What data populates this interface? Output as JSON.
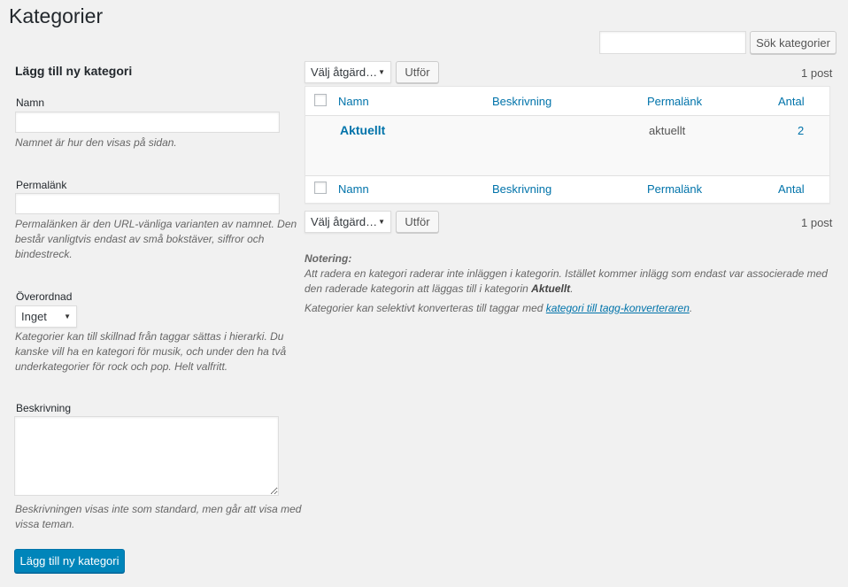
{
  "page": {
    "title": "Kategorier"
  },
  "search": {
    "button_label": "Sök kategorier",
    "value": ""
  },
  "add_form": {
    "heading": "Lägg till ny kategori",
    "name_label": "Namn",
    "name_value": "",
    "name_desc": "Namnet är hur den visas på sidan.",
    "slug_label": "Permalänk",
    "slug_value": "",
    "slug_desc_1": "Permalänken är den URL-vänliga varianten av namnet. Den",
    "slug_desc_2": "består vanligtvis endast av små bokstäver, siffror och",
    "slug_desc_3": "bindestreck.",
    "parent_label": "Överordnad",
    "parent_value": "Inget",
    "parent_desc_1": "Kategorier kan till skillnad från taggar sättas i hierarki. Du",
    "parent_desc_2": "kanske vill ha en kategori för musik, och under den ha två",
    "parent_desc_3": "underkategorier för rock och pop. Helt valfritt.",
    "desc_label": "Beskrivning",
    "desc_value": "",
    "desc_desc_1": "Beskrivningen visas inte som standard, men går att visa med",
    "desc_desc_2": "vissa teman.",
    "submit_label": "Lägg till ny kategori"
  },
  "bulk": {
    "select_label": "Välj åtgärd…",
    "apply_label": "Utför",
    "count_text": "1 post"
  },
  "table": {
    "columns": [
      "Namn",
      "Beskrivning",
      "Permalänk",
      "Antal"
    ],
    "rows": [
      {
        "name": "Aktuellt",
        "description": "",
        "slug": "aktuellt",
        "count": "2"
      }
    ]
  },
  "note": {
    "heading": "Notering:",
    "line1": "Att radera en kategori raderar inte inläggen i kategorin. Istället kommer inlägg som endast var associerade med",
    "line2_prefix": "den raderade kategorin att läggas till i kategorin ",
    "line2_bold": "Aktuellt",
    "line2_suffix": ".",
    "line3_prefix": "Kategorier kan selektivt konverteras till taggar med ",
    "line3_link": "kategori till tagg-konverteraren",
    "line3_suffix": "."
  },
  "colors": {
    "accent": "#0073aa",
    "primary_button": "#0085ba",
    "background": "#f1f1f1"
  }
}
